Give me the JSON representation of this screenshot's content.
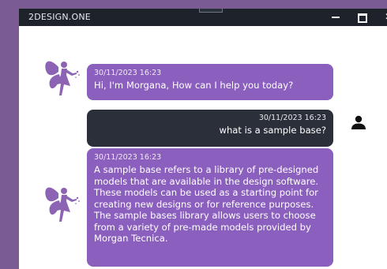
{
  "window": {
    "title": "2DESIGN.ONE",
    "controls": {
      "minimize_icon": "minimize-icon",
      "maximize_icon": "maximize-icon",
      "close_icon": "close-icon"
    }
  },
  "messages": [
    {
      "sender": "bot",
      "timestamp": "30/11/2023 16:23",
      "text": "Hi, I'm Morgana, How can I help you today?"
    },
    {
      "sender": "user",
      "timestamp": "30/11/2023 16:23",
      "text": "what is a sample base?"
    },
    {
      "sender": "bot",
      "timestamp": "30/11/2023 16:23",
      "text": "A sample base refers to a library of pre-designed models that are available in the design software. These models can be used as a starting point for creating new designs or for reference purposes. The sample bases library allows users to choose from a variety of pre-made models provided by Morgan Tecnica."
    }
  ],
  "colors": {
    "desktop": "#7b5b93",
    "bot_bubble": "#8b5fbd",
    "user_bubble": "#2a2f39",
    "titlebar": "#1e232b",
    "fairy": "#8d63b4"
  },
  "icons": {
    "bot_avatar": "fairy-icon",
    "user_avatar": "user-icon"
  }
}
